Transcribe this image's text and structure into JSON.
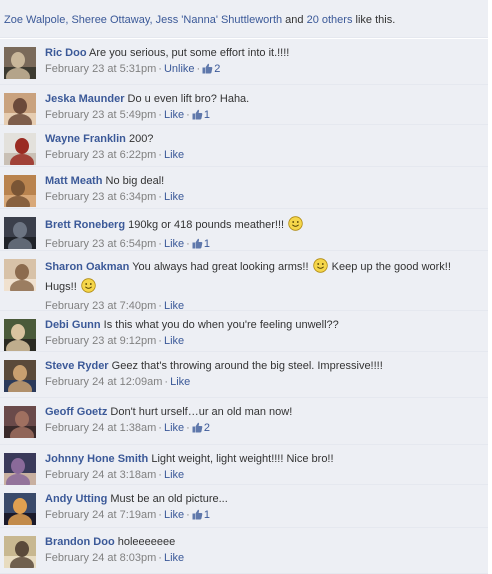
{
  "likes_summary": {
    "names": "Zoe Walpole, Sheree Ottaway, Jess 'Nanna' Shuttleworth",
    "and_text": " and ",
    "others": "20 others",
    "suffix": " like this."
  },
  "comments": [
    {
      "author": "Ric Doo",
      "text": "Are you serious, put some effort into it.!!!!",
      "time": "February 23 at 5:31pm",
      "like_label": "Unlike",
      "like_count": "2",
      "avatar_colors": [
        "#7a6a5a",
        "#c9b79a",
        "#3c3a30"
      ]
    },
    {
      "author": "Jeska Maunder",
      "text": "Do u even lift bro? Haha.",
      "time": "February 23 at 5:49pm",
      "like_label": "Like",
      "like_count": "1",
      "avatar_colors": [
        "#c9a27e",
        "#6b4a3a",
        "#e6cdb1"
      ]
    },
    {
      "author": "Wayne Franklin",
      "text": "200?",
      "time": "February 23 at 6:22pm",
      "like_label": "Like",
      "like_count": "",
      "avatar_colors": [
        "#e3e1dc",
        "#9a2b22",
        "#c9c0b5"
      ]
    },
    {
      "author": "Matt Meath",
      "text": "No big deal!",
      "time": "February 23 at 6:34pm",
      "like_label": "Like",
      "like_count": "",
      "avatar_colors": [
        "#b9834e",
        "#7a5535",
        "#d8a878"
      ]
    },
    {
      "author": "Brett Roneberg",
      "text_before": "190kg or 418 pounds meather!!!",
      "text_after": "",
      "time": "February 23 at 6:54pm",
      "like_label": "Like",
      "like_count": "1",
      "avatar_colors": [
        "#3b3f4b",
        "#6c7482",
        "#1f2228"
      ]
    },
    {
      "author": "Sharon Oakman",
      "text_before": "You always had great looking arms!!",
      "text_middle": "Keep up the good work!! Hugs!!",
      "time": "February 23 at 7:40pm",
      "like_label": "Like",
      "like_count": "",
      "avatar_colors": [
        "#d8c2a8",
        "#8c6b4e",
        "#f0e1cf"
      ]
    },
    {
      "author": "Debi Gunn",
      "text": "Is this what you do when you're feeling unwell??",
      "time": "February 23 at 9:12pm",
      "like_label": "Like",
      "like_count": "",
      "avatar_colors": [
        "#4a5a3a",
        "#d9c4a0",
        "#2a2a22"
      ]
    },
    {
      "author": "Steve Ryder",
      "text": "Geez that's throwing around the big steel. Impressive!!!!",
      "time": "February 24 at 12:09am",
      "like_label": "Like",
      "like_count": "",
      "avatar_colors": [
        "#5a4a3a",
        "#c8a070",
        "#2b3a5a"
      ]
    },
    {
      "author": "Geoff Goetz",
      "text": "Don't hurt urself…ur an old man now!",
      "time": "February 24 at 1:38am",
      "like_label": "Like",
      "like_count": "2",
      "avatar_colors": [
        "#6a4a4a",
        "#a07060",
        "#3a2a2a"
      ]
    },
    {
      "author": "Johnny Hone Smith",
      "text": "Light weight, light weight!!!! Nice bro!!",
      "time": "February 24 at 3:18am",
      "like_label": "Like",
      "like_count": "",
      "avatar_colors": [
        "#3a3a5a",
        "#8a6a9a",
        "#c8b0a0"
      ]
    },
    {
      "author": "Andy Utting",
      "text": "Must be an old picture...",
      "time": "February 24 at 7:19am",
      "like_label": "Like",
      "like_count": "1",
      "avatar_colors": [
        "#3a4a6a",
        "#e0a050",
        "#1a1a2a"
      ]
    },
    {
      "author": "Brandon Doo",
      "text": "holeeeeeee",
      "time": "February 24 at 8:03pm",
      "like_label": "Like",
      "like_count": "",
      "avatar_colors": [
        "#c8b890",
        "#5a4a3a",
        "#e8dcc0"
      ]
    }
  ],
  "colors": {
    "link": "#3b5998",
    "background": "#edeff4",
    "meta": "#808080"
  },
  "icons": {
    "thumb": "thumbs-up-icon",
    "smiley": "smiley-icon"
  }
}
